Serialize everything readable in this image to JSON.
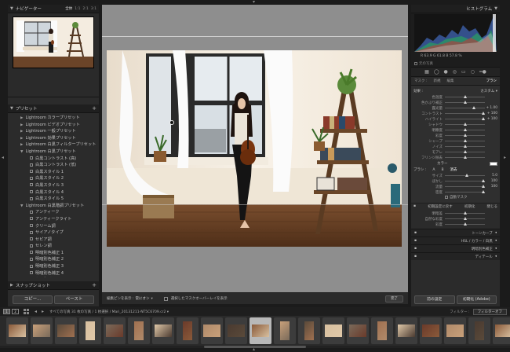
{
  "navigator": {
    "title": "ナビゲーター",
    "options": [
      "全体",
      "1:1",
      "2:1",
      "3:1"
    ],
    "selected_option": "全体"
  },
  "presets": {
    "title": "プリセット",
    "items": [
      {
        "level": 0,
        "label": "Lightroom カラープリセット",
        "open": false
      },
      {
        "level": 0,
        "label": "Lightroom ビデオプリセット",
        "open": false
      },
      {
        "level": 0,
        "label": "Lightroom 一般プリセット",
        "open": false
      },
      {
        "level": 0,
        "label": "Lightroom 効果プリセット",
        "open": false
      },
      {
        "level": 0,
        "label": "Lightroom 白黒フィルタープリセット",
        "open": false
      },
      {
        "level": 0,
        "label": "Lightroom 白黒プリセット",
        "open": true
      },
      {
        "level": 1,
        "label": "白黒コントラスト (高)"
      },
      {
        "level": 1,
        "label": "白黒コントラスト (低)"
      },
      {
        "level": 1,
        "label": "白黒スタイル 1"
      },
      {
        "level": 1,
        "label": "白黒スタイル 2"
      },
      {
        "level": 1,
        "label": "白黒スタイル 3"
      },
      {
        "level": 1,
        "label": "白黒スタイル 4"
      },
      {
        "level": 1,
        "label": "白黒スタイル 5"
      },
      {
        "level": 0,
        "label": "Lightroom 白黒階調プリセット",
        "open": true
      },
      {
        "level": 1,
        "label": "アンティーク"
      },
      {
        "level": 1,
        "label": "アンティークライト"
      },
      {
        "level": 1,
        "label": "クリーム調"
      },
      {
        "level": 1,
        "label": "サイアノタイプ"
      },
      {
        "level": 1,
        "label": "セピア調"
      },
      {
        "level": 1,
        "label": "セレン調"
      },
      {
        "level": 1,
        "label": "明暗別色補正 1"
      },
      {
        "level": 1,
        "label": "明暗別色補正 2"
      },
      {
        "level": 1,
        "label": "明暗別色補正 3"
      },
      {
        "level": 1,
        "label": "明暗別色補正 4"
      },
      {
        "level": 0,
        "label": "ユーザープリセット",
        "open": false
      }
    ]
  },
  "snapshot": {
    "title": "スナップショット"
  },
  "left_buttons": {
    "copy": "コピー...",
    "paste": "ペースト"
  },
  "toolbar": {
    "edit_pin": "編集ピンを表示 :",
    "edit_pin_value": "常にオン",
    "overlay": "選択したマスクオーバーレイを表示",
    "done": "完了"
  },
  "histogram": {
    "title": "ヒストグラム",
    "readout": "R 63.9  G 61.8  B 57.8 %",
    "original": "元の写真"
  },
  "mask_tabs": {
    "mask": "マスク :",
    "new": "新規",
    "edit": "編集",
    "brush": "ブラシ"
  },
  "brush": {
    "effect_label": "効果 :",
    "effect_value": "カスタム",
    "sliders": [
      {
        "label": "色温度",
        "value": "",
        "pos": 0.5
      },
      {
        "label": "色かぶり補正",
        "value": "",
        "pos": 0.5
      },
      {
        "label": "露光量",
        "value": "+ 1.00",
        "pos": 0.72
      },
      {
        "label": "コントラスト",
        "value": "+ 100",
        "pos": 0.97
      },
      {
        "label": "ハイライト",
        "value": "+ 100",
        "pos": 0.97
      },
      {
        "label": "シャドウ",
        "value": "",
        "pos": 0.5
      },
      {
        "label": "明瞭度",
        "value": "",
        "pos": 0.5
      },
      {
        "label": "彩度",
        "value": "",
        "pos": 0.5
      },
      {
        "label": "シャープ",
        "value": "",
        "pos": 0.5
      },
      {
        "label": "ノイズ",
        "value": "",
        "pos": 0.5
      },
      {
        "label": "モアレ",
        "value": "",
        "pos": 0.5
      },
      {
        "label": "フリンジ除去",
        "value": "",
        "pos": 0.5
      }
    ],
    "color_label": "カラー",
    "brush_label": "ブラシ :",
    "tab_a": "A",
    "tab_b": "B",
    "tab_erase": "消去",
    "brush_sliders": [
      {
        "label": "サイズ",
        "value": "5.0",
        "pos": 0.55
      },
      {
        "label": "ぼかし",
        "value": "100",
        "pos": 0.97
      },
      {
        "label": "流量",
        "value": "100",
        "pos": 0.97
      },
      {
        "label": "密度",
        "value": "",
        "pos": 0.97
      }
    ],
    "auto_mask": "自動マスク",
    "reset": "初期設定に戻す",
    "close": "閉じる",
    "initialize": "初期化"
  },
  "right_sections": [
    {
      "title": "",
      "rows": [
        "明暗差",
        "自然な彩度",
        "彩度"
      ]
    },
    {
      "title": "トーンカーブ"
    },
    {
      "title": "HSL / カラー / 白黒"
    },
    {
      "title": "明暗別色補正"
    },
    {
      "title": "ディテール"
    }
  ],
  "right_buttons": {
    "previous": "前の設定",
    "reset": "初期化 (Adobe)"
  },
  "filmbar": {
    "monitor1": "1",
    "monitor2": "2",
    "path": "すべての写真  31 枚の写真 / 1 枚選択 / Mari_20131211-NT5C6709.cr2 ▾",
    "filter_label": "フィルター :",
    "filter_value": "フィルターオフ"
  },
  "filmstrip_count": 22,
  "filmstrip_selected": 10
}
